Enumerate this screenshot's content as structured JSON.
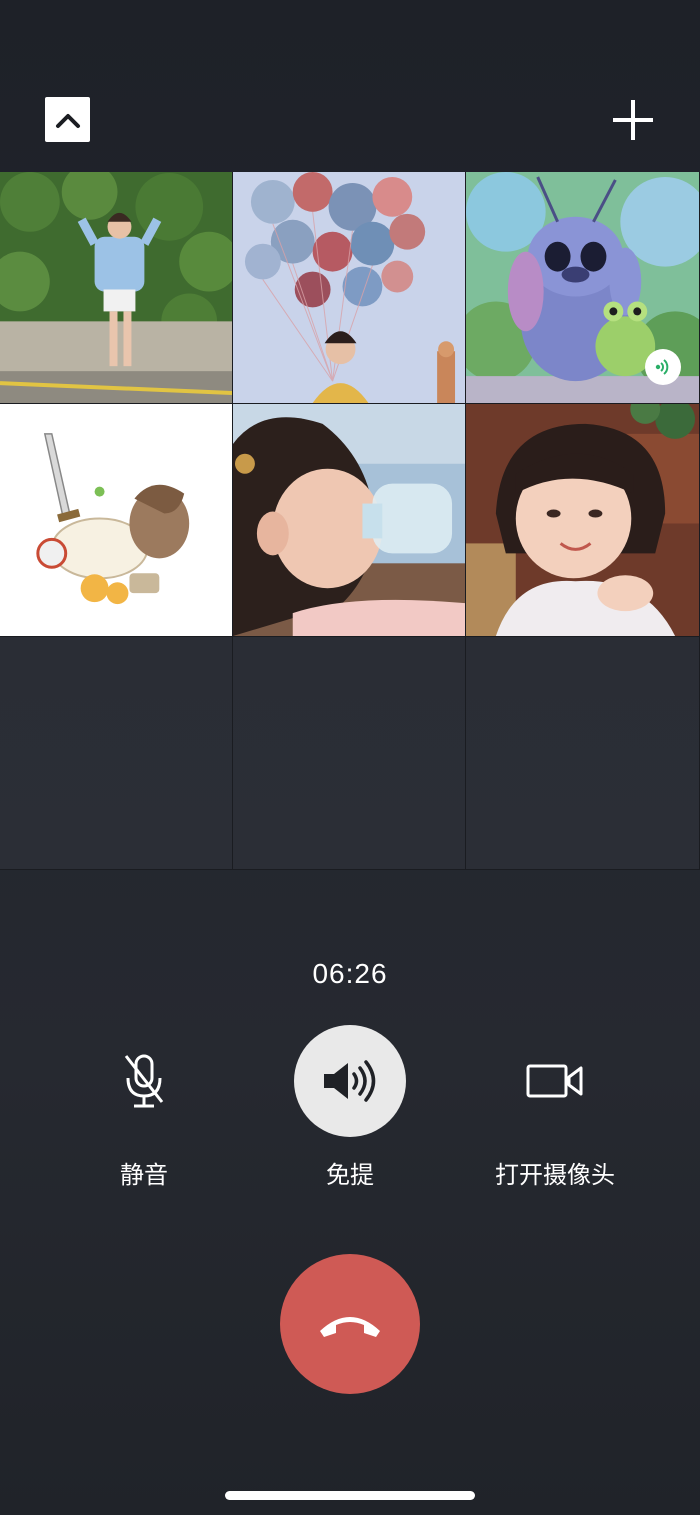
{
  "header": {
    "collapse_icon": "chevron-up-icon",
    "add_icon": "plus-icon"
  },
  "participants": [
    {
      "id": "p1",
      "kind": "photo",
      "scene": "woman in blue shirt by green hedge"
    },
    {
      "id": "p2",
      "kind": "photo",
      "scene": "woman holding balloons"
    },
    {
      "id": "p3",
      "kind": "cartoon",
      "scene": "blue alien with frog",
      "speaking": true
    },
    {
      "id": "p4",
      "kind": "cartoon",
      "scene": "sketch character with sword"
    },
    {
      "id": "p5",
      "kind": "photo",
      "scene": "child drinking from bottle"
    },
    {
      "id": "p6",
      "kind": "photo",
      "scene": "smiling child"
    }
  ],
  "call": {
    "timer": "06:26"
  },
  "controls": [
    {
      "id": "mute",
      "label": "静音",
      "icon": "microphone-muted-icon",
      "active": false
    },
    {
      "id": "speaker",
      "label": "免提",
      "icon": "speaker-icon",
      "active": true
    },
    {
      "id": "camera",
      "label": "打开摄像头",
      "icon": "video-camera-icon",
      "active": false
    }
  ],
  "hangup": {
    "icon": "hang-up-phone-icon",
    "color": "#cf5a55"
  },
  "colors": {
    "background": "#23262e",
    "speaking_indicator": "#2aae67",
    "hangup": "#cf5a55",
    "active_control": "#e9e9e9"
  }
}
